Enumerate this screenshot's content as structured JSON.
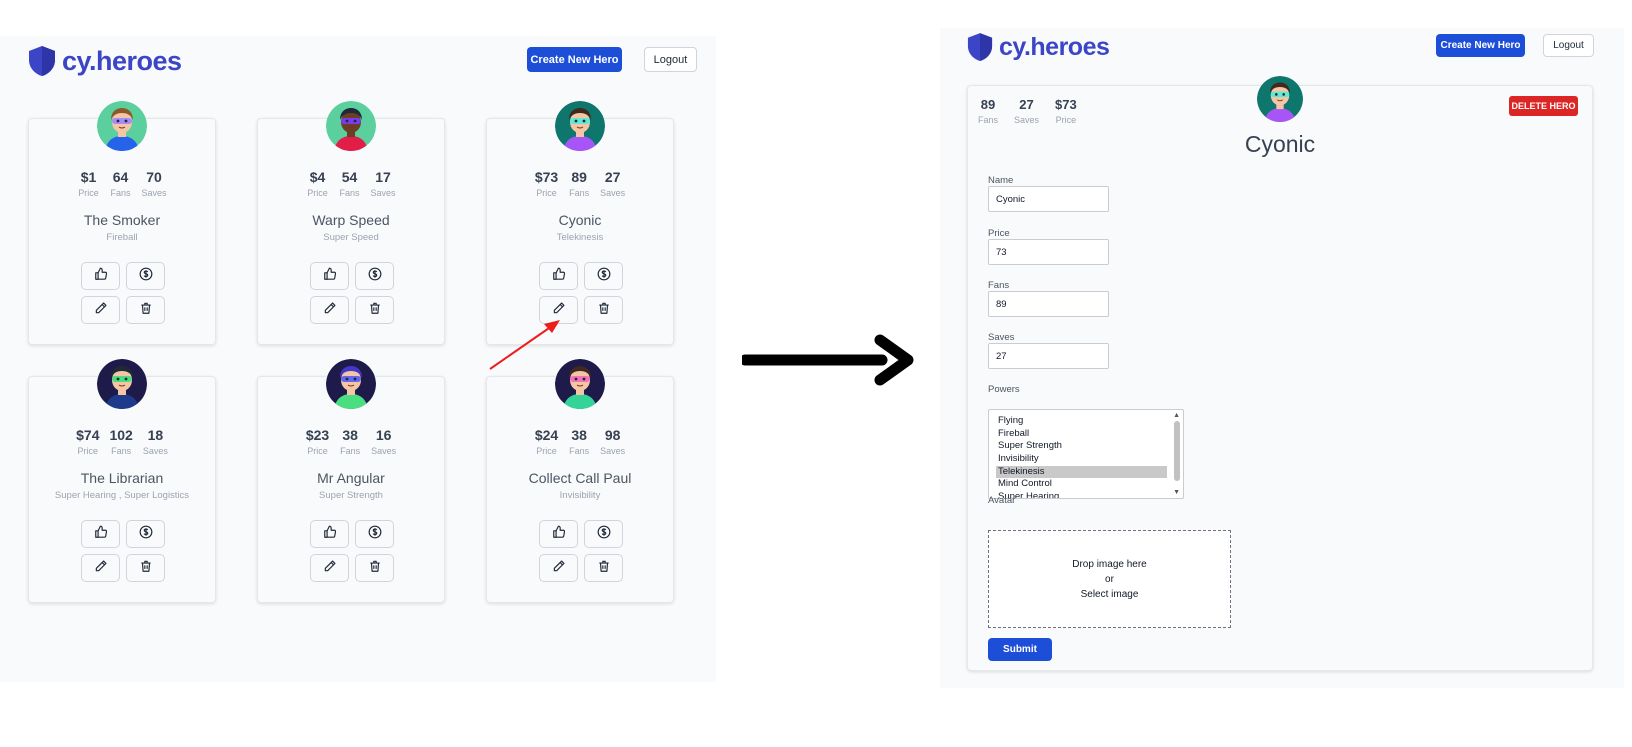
{
  "app": {
    "logo_text": "cy.heroes",
    "create_button": "Create New Hero",
    "logout_button": "Logout",
    "brand_color": "#3b45c6",
    "primary_color": "#1d4ed8"
  },
  "stat_labels": {
    "price": "Price",
    "fans": "Fans",
    "saves": "Saves"
  },
  "heroes": [
    {
      "name": "The Smoker",
      "price": "$1",
      "fans": "64",
      "saves": "70",
      "powers": "Fireball",
      "skin": "#f5c6a5",
      "hair": "#8b5a2b",
      "bg": "#5bcf9e",
      "mask": "#a78bfa",
      "shirt": "#2563eb"
    },
    {
      "name": "Warp Speed",
      "price": "$4",
      "fans": "54",
      "saves": "17",
      "powers": "Super Speed",
      "skin": "#6b3f24",
      "hair": "#1f2937",
      "bg": "#5bcf9e",
      "mask": "#7c3aed",
      "shirt": "#e11d48"
    },
    {
      "name": "Cyonic",
      "price": "$73",
      "fans": "89",
      "saves": "27",
      "powers": "Telekinesis",
      "skin": "#f5c6a5",
      "hair": "#3f2a1d",
      "bg": "#0f766e",
      "mask": "#5eead4",
      "shirt": "#a855f7"
    },
    {
      "name": "The Librarian",
      "price": "$74",
      "fans": "102",
      "saves": "18",
      "powers": "Super Hearing ,  Super Logistics",
      "skin": "#f5c6a5",
      "hair": "#1f2937",
      "bg": "#1e1b4b",
      "mask": "#4ade80",
      "shirt": "#1e3a8a"
    },
    {
      "name": "Mr Angular",
      "price": "$23",
      "fans": "38",
      "saves": "16",
      "powers": "Super Strength",
      "skin": "#f5c6a5",
      "hair": "#4338ca",
      "bg": "#1e1b4b",
      "mask": "#6366f1",
      "shirt": "#4ade80"
    },
    {
      "name": "Collect Call Paul",
      "price": "$24",
      "fans": "38",
      "saves": "98",
      "powers": "Invisibility",
      "skin": "#f5c6a5",
      "hair": "#3f2a1d",
      "bg": "#1e1b4b",
      "mask": "#f472b6",
      "shirt": "#34d399"
    }
  ],
  "edit": {
    "fans": "89",
    "saves": "27",
    "price": "$73",
    "delete_button": "DELETE HERO",
    "title": "Cyonic",
    "fields": {
      "name": {
        "label": "Name",
        "value": "Cyonic"
      },
      "price": {
        "label": "Price",
        "value": "73"
      },
      "fans": {
        "label": "Fans",
        "value": "89"
      },
      "saves": {
        "label": "Saves",
        "value": "27"
      }
    },
    "powers_label": "Powers",
    "powers_options": [
      "Flying",
      "Fireball",
      "Super Strength",
      "Invisibility",
      "Telekinesis",
      "Mind Control",
      "Super Hearing"
    ],
    "powers_selected": "Telekinesis",
    "avatar_label": "Avatar",
    "drop_line1": "Drop image here",
    "drop_line2": "or",
    "drop_line3": "Select image",
    "submit_button": "Submit"
  }
}
